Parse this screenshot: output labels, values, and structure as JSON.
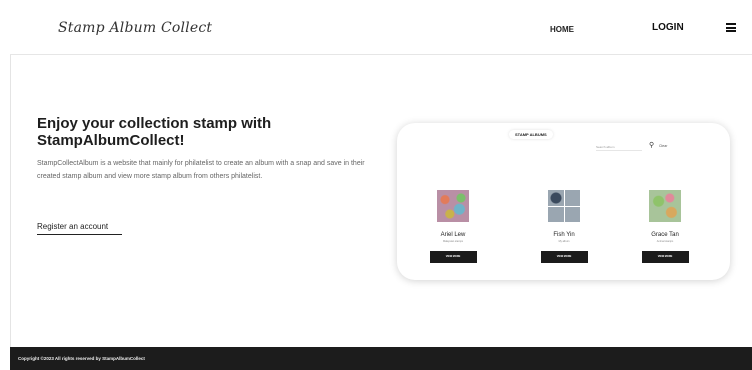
{
  "header": {
    "logo_text": "Stamp Album Collect",
    "nav": {
      "home": "HOME",
      "login": "LOGIN"
    }
  },
  "hero": {
    "title": "Enjoy your collection stamp with StampAlbumCollect!",
    "description": "StampCollectAlbum is a website that mainly for philatelist to create an album with a snap and save in their created stamp album and view more stamp album from others philatelist.",
    "register_label": "Register an account"
  },
  "preview": {
    "tab_label": "STAMP ALBUMS",
    "search_placeholder": "Search album",
    "clear_label": "Clear",
    "albums": [
      {
        "name": "Ariel Lew",
        "sub": "Malaysian stamps",
        "button": "VIEW MORE"
      },
      {
        "name": "Fish Yin",
        "sub": "My album",
        "button": "VIEW MORE"
      },
      {
        "name": "Grace Tan",
        "sub": "Animal stamps",
        "button": "VIEW MORE"
      }
    ]
  },
  "footer": {
    "copyright": "Copyright ©2023 All rights reserved by StampAlbumCollect"
  }
}
